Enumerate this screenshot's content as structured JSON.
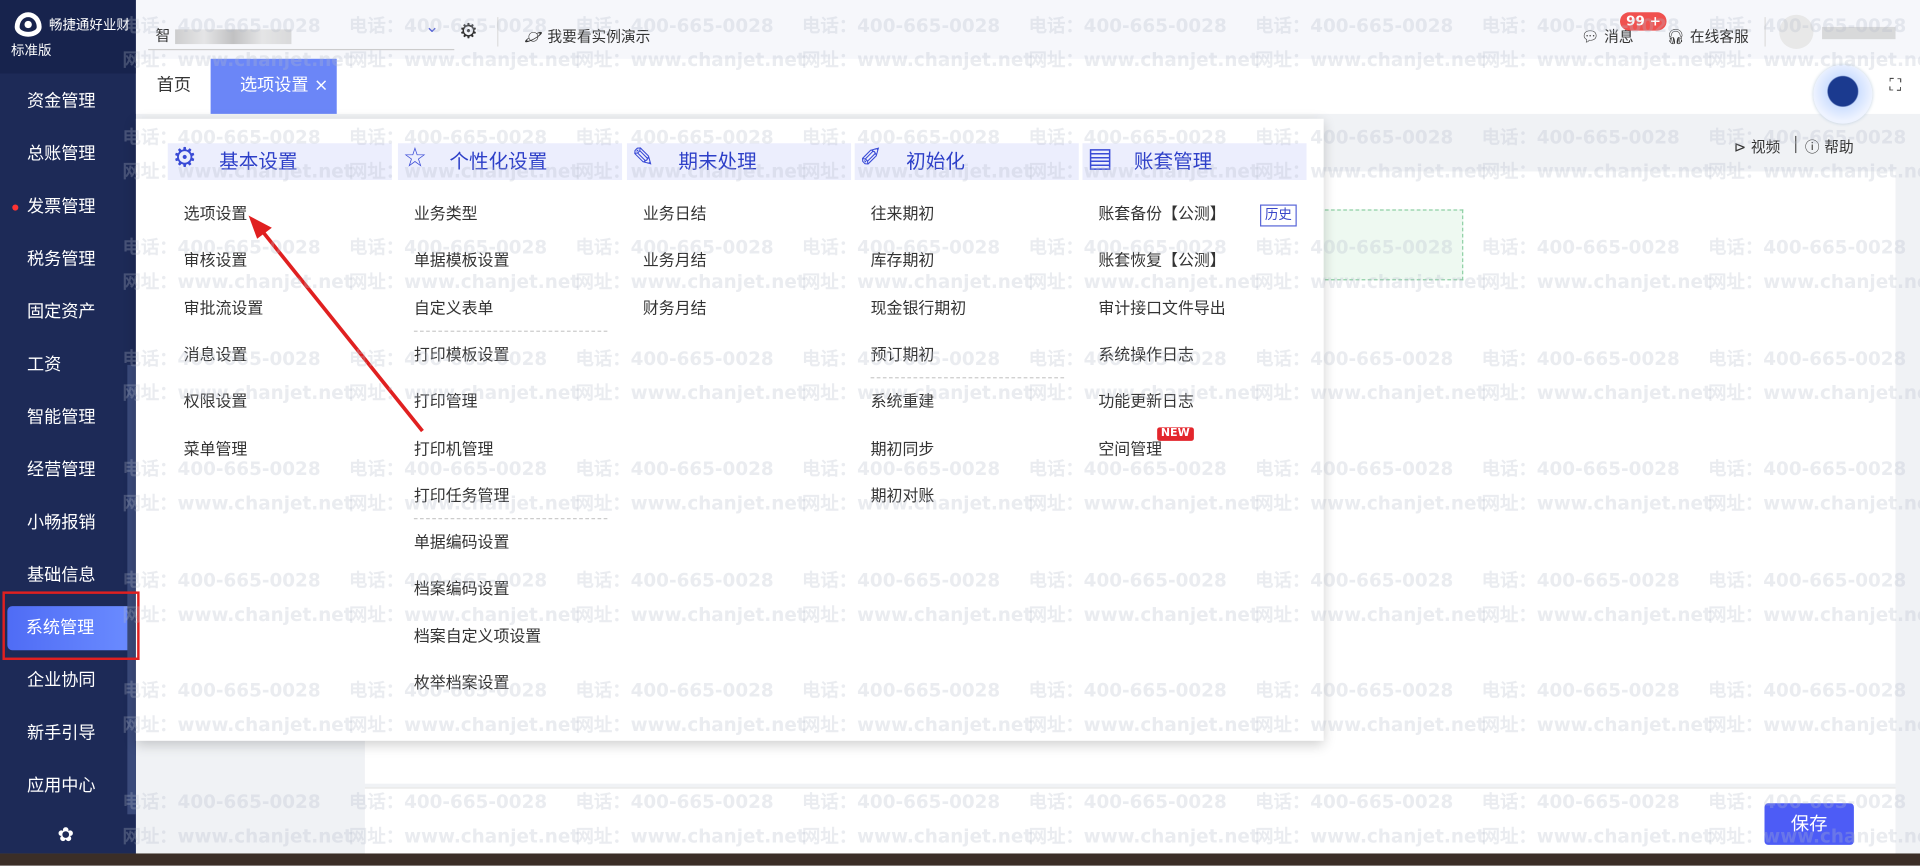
{
  "brand": {
    "name": "畅捷通好业财",
    "edition": "标准版"
  },
  "sidebar": {
    "items": [
      {
        "label": "资金管理"
      },
      {
        "label": "总账管理"
      },
      {
        "label": "发票管理",
        "dot": true
      },
      {
        "label": "税务管理"
      },
      {
        "label": "固定资产"
      },
      {
        "label": "工资"
      },
      {
        "label": "智能管理"
      },
      {
        "label": "经营管理"
      },
      {
        "label": "小畅报销"
      },
      {
        "label": "基础信息"
      },
      {
        "label": "系统管理",
        "active": true
      },
      {
        "label": "企业协同"
      },
      {
        "label": "新手引导"
      },
      {
        "label": "应用中心"
      }
    ]
  },
  "topbar": {
    "company_prefix": "智",
    "demo": "我要看实例演示",
    "messages": "消息",
    "badge": "99 +",
    "service": "在线客服"
  },
  "tabs": {
    "home": "首页",
    "active": "选项设置",
    "close": "×"
  },
  "toolbar": {
    "video": "视频",
    "help": "帮助"
  },
  "watermark": {
    "phone": "电话：400-665-0028",
    "site": "网址：www.chanjet.net"
  },
  "menu": {
    "columns": [
      {
        "title": "基本设置",
        "icon": "gear-doc-icon",
        "items": [
          "选项设置",
          "审核设置",
          "审批流设置",
          "消息设置",
          "权限设置",
          "菜单管理"
        ]
      },
      {
        "title": "个性化设置",
        "icon": "star-icon",
        "items": [
          "业务类型",
          "单据模板设置",
          "自定义表单",
          "打印模板设置",
          "打印管理",
          "打印机管理",
          "打印任务管理",
          "单据编码设置",
          "档案编码设置",
          "档案自定义项设置",
          "枚举档案设置"
        ]
      },
      {
        "title": "期末处理",
        "icon": "period-end-icon",
        "items": [
          "业务日结",
          "业务月结",
          "财务月结"
        ]
      },
      {
        "title": "初始化",
        "icon": "broom-icon",
        "items": [
          "往来期初",
          "库存期初",
          "现金银行期初",
          "预订期初",
          "系统重建",
          "期初同步",
          "期初对账"
        ]
      },
      {
        "title": "账套管理",
        "icon": "ledger-icon",
        "items": [
          "账套备份【公测】",
          "账套恢复【公测】",
          "审计接口文件导出",
          "系统操作日志",
          "功能更新日志",
          "空间管理"
        ]
      }
    ],
    "history": "历史",
    "new_badge": "NEW"
  },
  "footer": {
    "save": "保存"
  },
  "colors": {
    "sidebar": "#1d2a57",
    "accent": "#4d5cf6",
    "tab_active": "#6b86f7",
    "annotation": "#e02020"
  }
}
